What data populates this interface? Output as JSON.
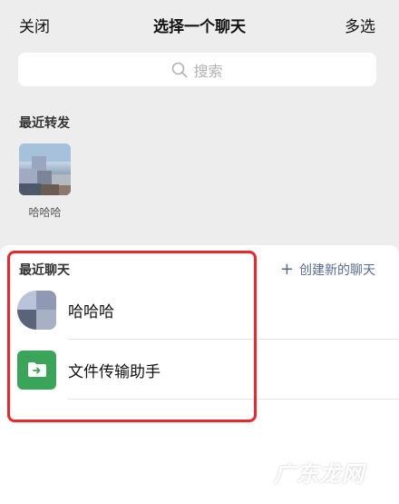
{
  "header": {
    "close_label": "关闭",
    "title": "选择一个聊天",
    "multi_select_label": "多选"
  },
  "search": {
    "placeholder": "搜索"
  },
  "recent_forward": {
    "label": "最近转发",
    "items": [
      {
        "name": "哈哈哈"
      }
    ]
  },
  "recent_chats": {
    "label": "最近聊天",
    "create_label": "创建新的聊天",
    "items": [
      {
        "name": "哈哈哈",
        "avatar": "blurred-photo"
      },
      {
        "name": "文件传输助手",
        "avatar": "file-transfer-icon"
      }
    ]
  },
  "colors": {
    "background": "#ededed",
    "link": "#576b95",
    "file_icon_bg": "#3aa559",
    "highlight": "#e8282b"
  },
  "watermark": "广东龙网"
}
